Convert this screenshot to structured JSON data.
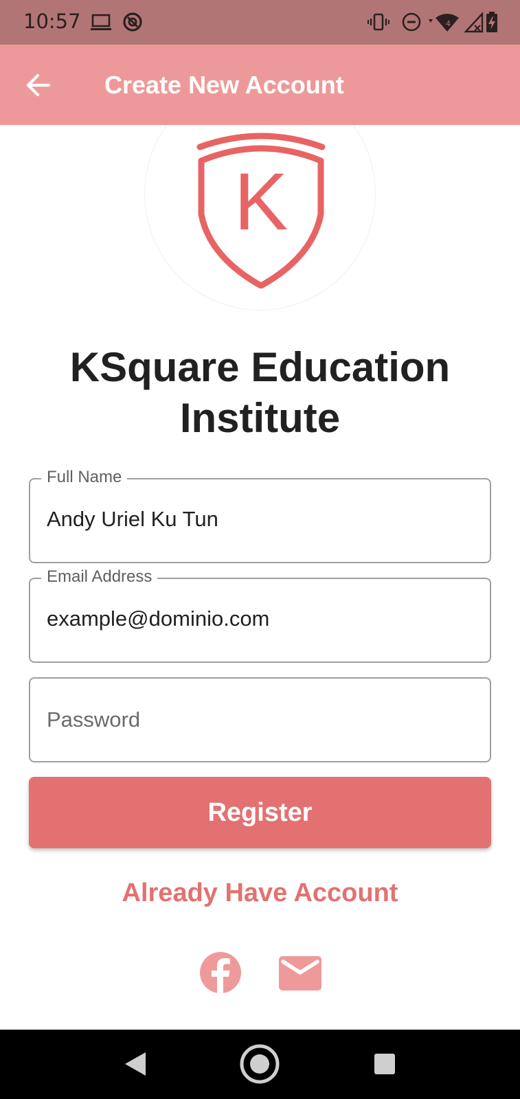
{
  "status_bar": {
    "time": "10:57",
    "icons": [
      "laptop-icon",
      "ring-icon",
      "vibrate-icon",
      "do-not-disturb-icon",
      "wifi-icon",
      "signal-icon",
      "battery-icon"
    ]
  },
  "app_bar": {
    "title": "Create New Account",
    "back_icon": "arrow-back-icon"
  },
  "logo": {
    "letter": "K",
    "color": "#e86464"
  },
  "institution_name": "KSquare Education Institute",
  "form": {
    "full_name": {
      "label": "Full Name",
      "value": "Andy Uriel Ku Tun"
    },
    "email": {
      "label": "Email Address",
      "value": "example@dominio.com"
    },
    "password": {
      "placeholder": "Password",
      "value": ""
    }
  },
  "register_button": {
    "label": "Register"
  },
  "already_have_account": {
    "label": "Already Have Account"
  },
  "social": [
    "facebook-icon",
    "mail-icon"
  ],
  "colors": {
    "status_bar": "#b27575",
    "app_bar": "#ee9999",
    "accent": "#e37171",
    "social": "#ef9a9a"
  },
  "nav_bar": [
    "nav-back-icon",
    "nav-home-icon",
    "nav-recents-icon"
  ]
}
